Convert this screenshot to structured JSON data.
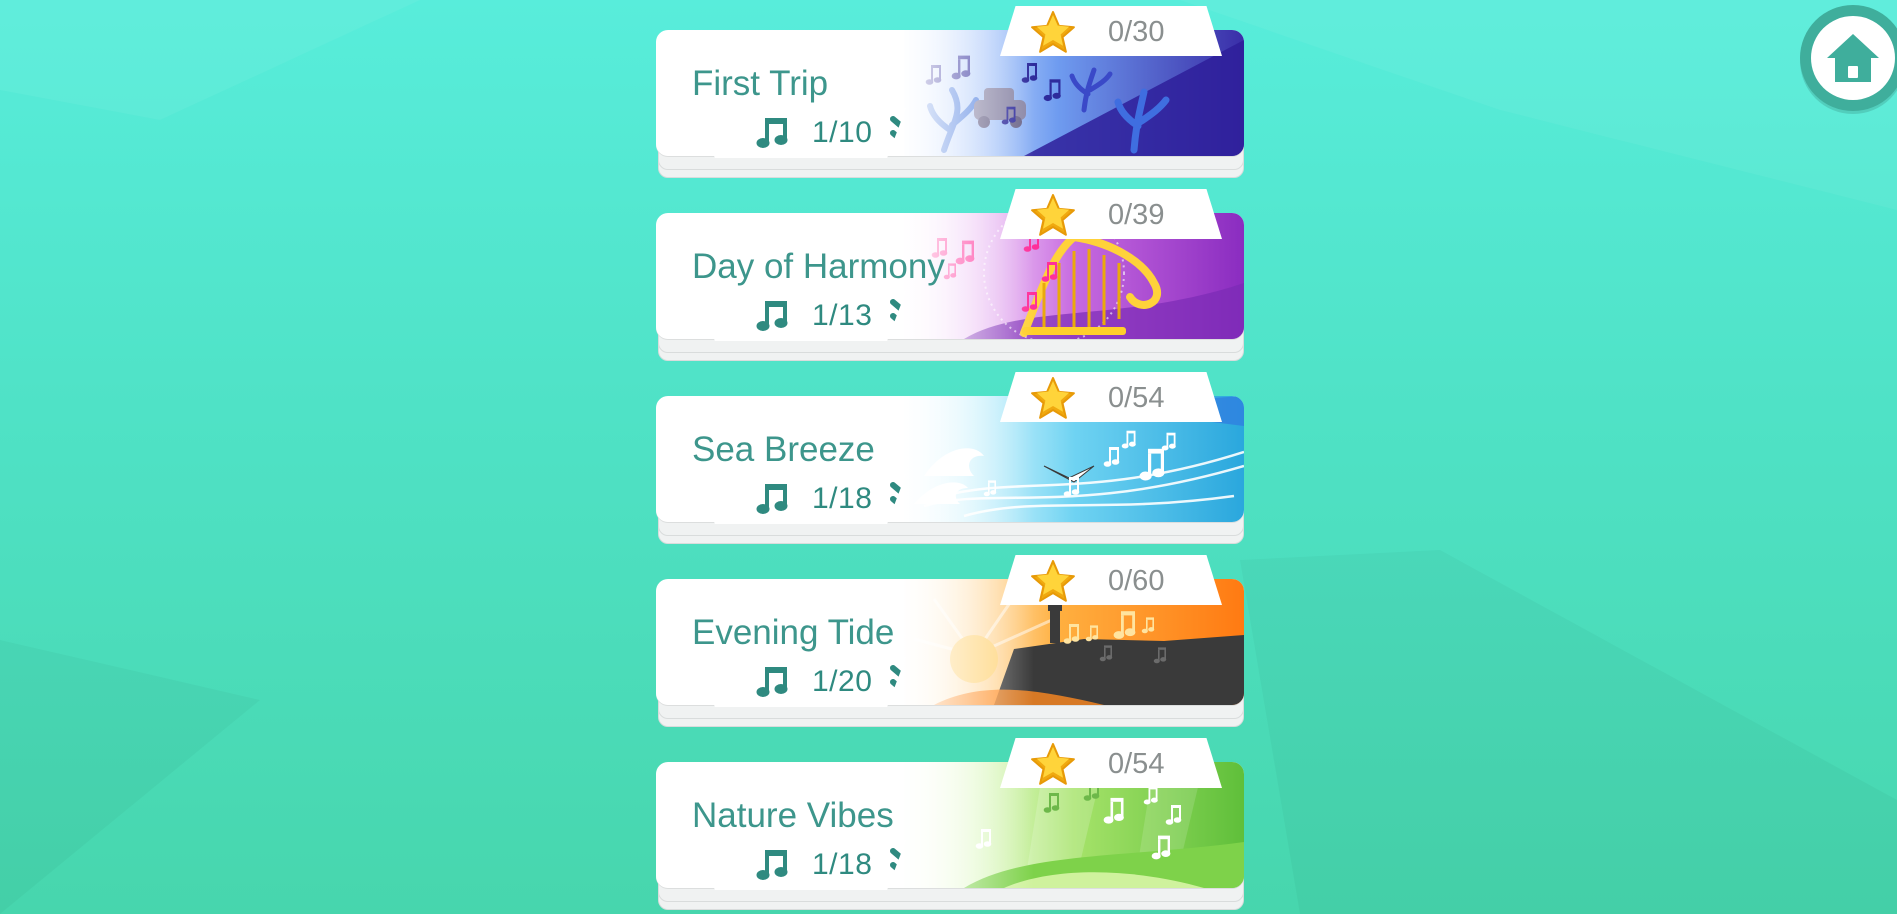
{
  "home": {
    "icon": "home-icon"
  },
  "levels": [
    {
      "title": "First Trip",
      "songs": "1/10",
      "stars": "0/30",
      "theme_colors": [
        "#6f9cf0",
        "#3a2ea8"
      ]
    },
    {
      "title": "Day of Harmony",
      "songs": "1/13",
      "stars": "0/39",
      "theme_colors": [
        "#e6a7ee",
        "#8a2cc0"
      ]
    },
    {
      "title": "Sea Breeze",
      "songs": "1/18",
      "stars": "0/54",
      "theme_colors": [
        "#8fe3f7",
        "#2aa7dd"
      ]
    },
    {
      "title": "Evening Tide",
      "songs": "1/20",
      "stars": "0/60",
      "theme_colors": [
        "#ffcc73",
        "#ff7a12"
      ]
    },
    {
      "title": "Nature Vibes",
      "songs": "1/18",
      "stars": "0/54",
      "theme_colors": [
        "#c6f08a",
        "#5fbf3a"
      ]
    }
  ],
  "colors": {
    "background": "#4fe2c6",
    "title": "#3d968c",
    "count": "#2f8a80",
    "star": "#f6c31a",
    "stars_text": "#8a8f8f"
  },
  "icons": {
    "song_count": "music-note-icon",
    "expand": "double-chevron-down-icon",
    "stars": "star-icon"
  }
}
